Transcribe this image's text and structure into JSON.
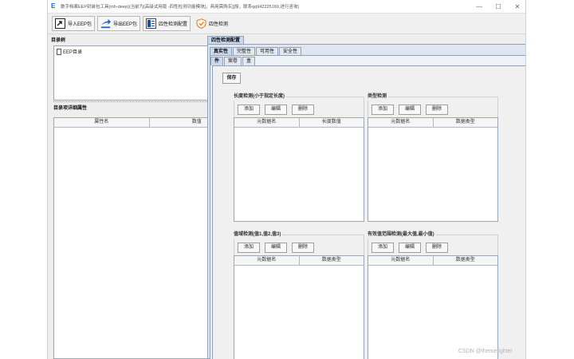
{
  "window": {
    "title": "数字档案EEP封装包工具(mh-deep)(当前为[高级试用版 -四性检测功能模块]，商用需购买][授，联系qq942225169,进行咨询)",
    "app_icon": "E",
    "controls": {
      "minimize": "—",
      "maximize": "☐",
      "close": "✕"
    }
  },
  "toolbar": {
    "import_label": "导入EEP包",
    "export_label": "导出EEP包",
    "config_label": "四性检测配置",
    "check_label": "四性检测"
  },
  "left": {
    "tree_title": "目录树",
    "tree_items": [
      {
        "label": "EEP目录"
      }
    ],
    "attr_title": "目录项详细属性",
    "attr_columns": {
      "name": "属性名",
      "value": "数值"
    }
  },
  "right": {
    "main_tab": "四性检测配置",
    "sub_tabs": [
      "真实性",
      "完整性",
      "可用性",
      "安全性"
    ],
    "level_tabs": [
      "件",
      "案卷",
      "盒"
    ],
    "save_label": "保存",
    "groups": [
      {
        "title": "长度检测(小于指定长度)",
        "col1": "元数据名",
        "col2": "长度数值"
      },
      {
        "title": "类型检测",
        "col1": "元数据名",
        "col2": "数据类型"
      },
      {
        "title": "值域检测(值1,值2,值3)",
        "col1": "元数据名",
        "col2": "数据类型"
      },
      {
        "title": "有效值范围检测(最大值,最小值)",
        "col1": "元数据名",
        "col2": "数据类型"
      }
    ],
    "btn_add": "添加",
    "btn_edit": "编辑",
    "btn_delete": "删除"
  },
  "watermark": "CSDN @themefighter",
  "colors": {
    "accent": "#1a62c6",
    "tab_active": "#c9d9ee",
    "frame": "#8fa0b7"
  }
}
